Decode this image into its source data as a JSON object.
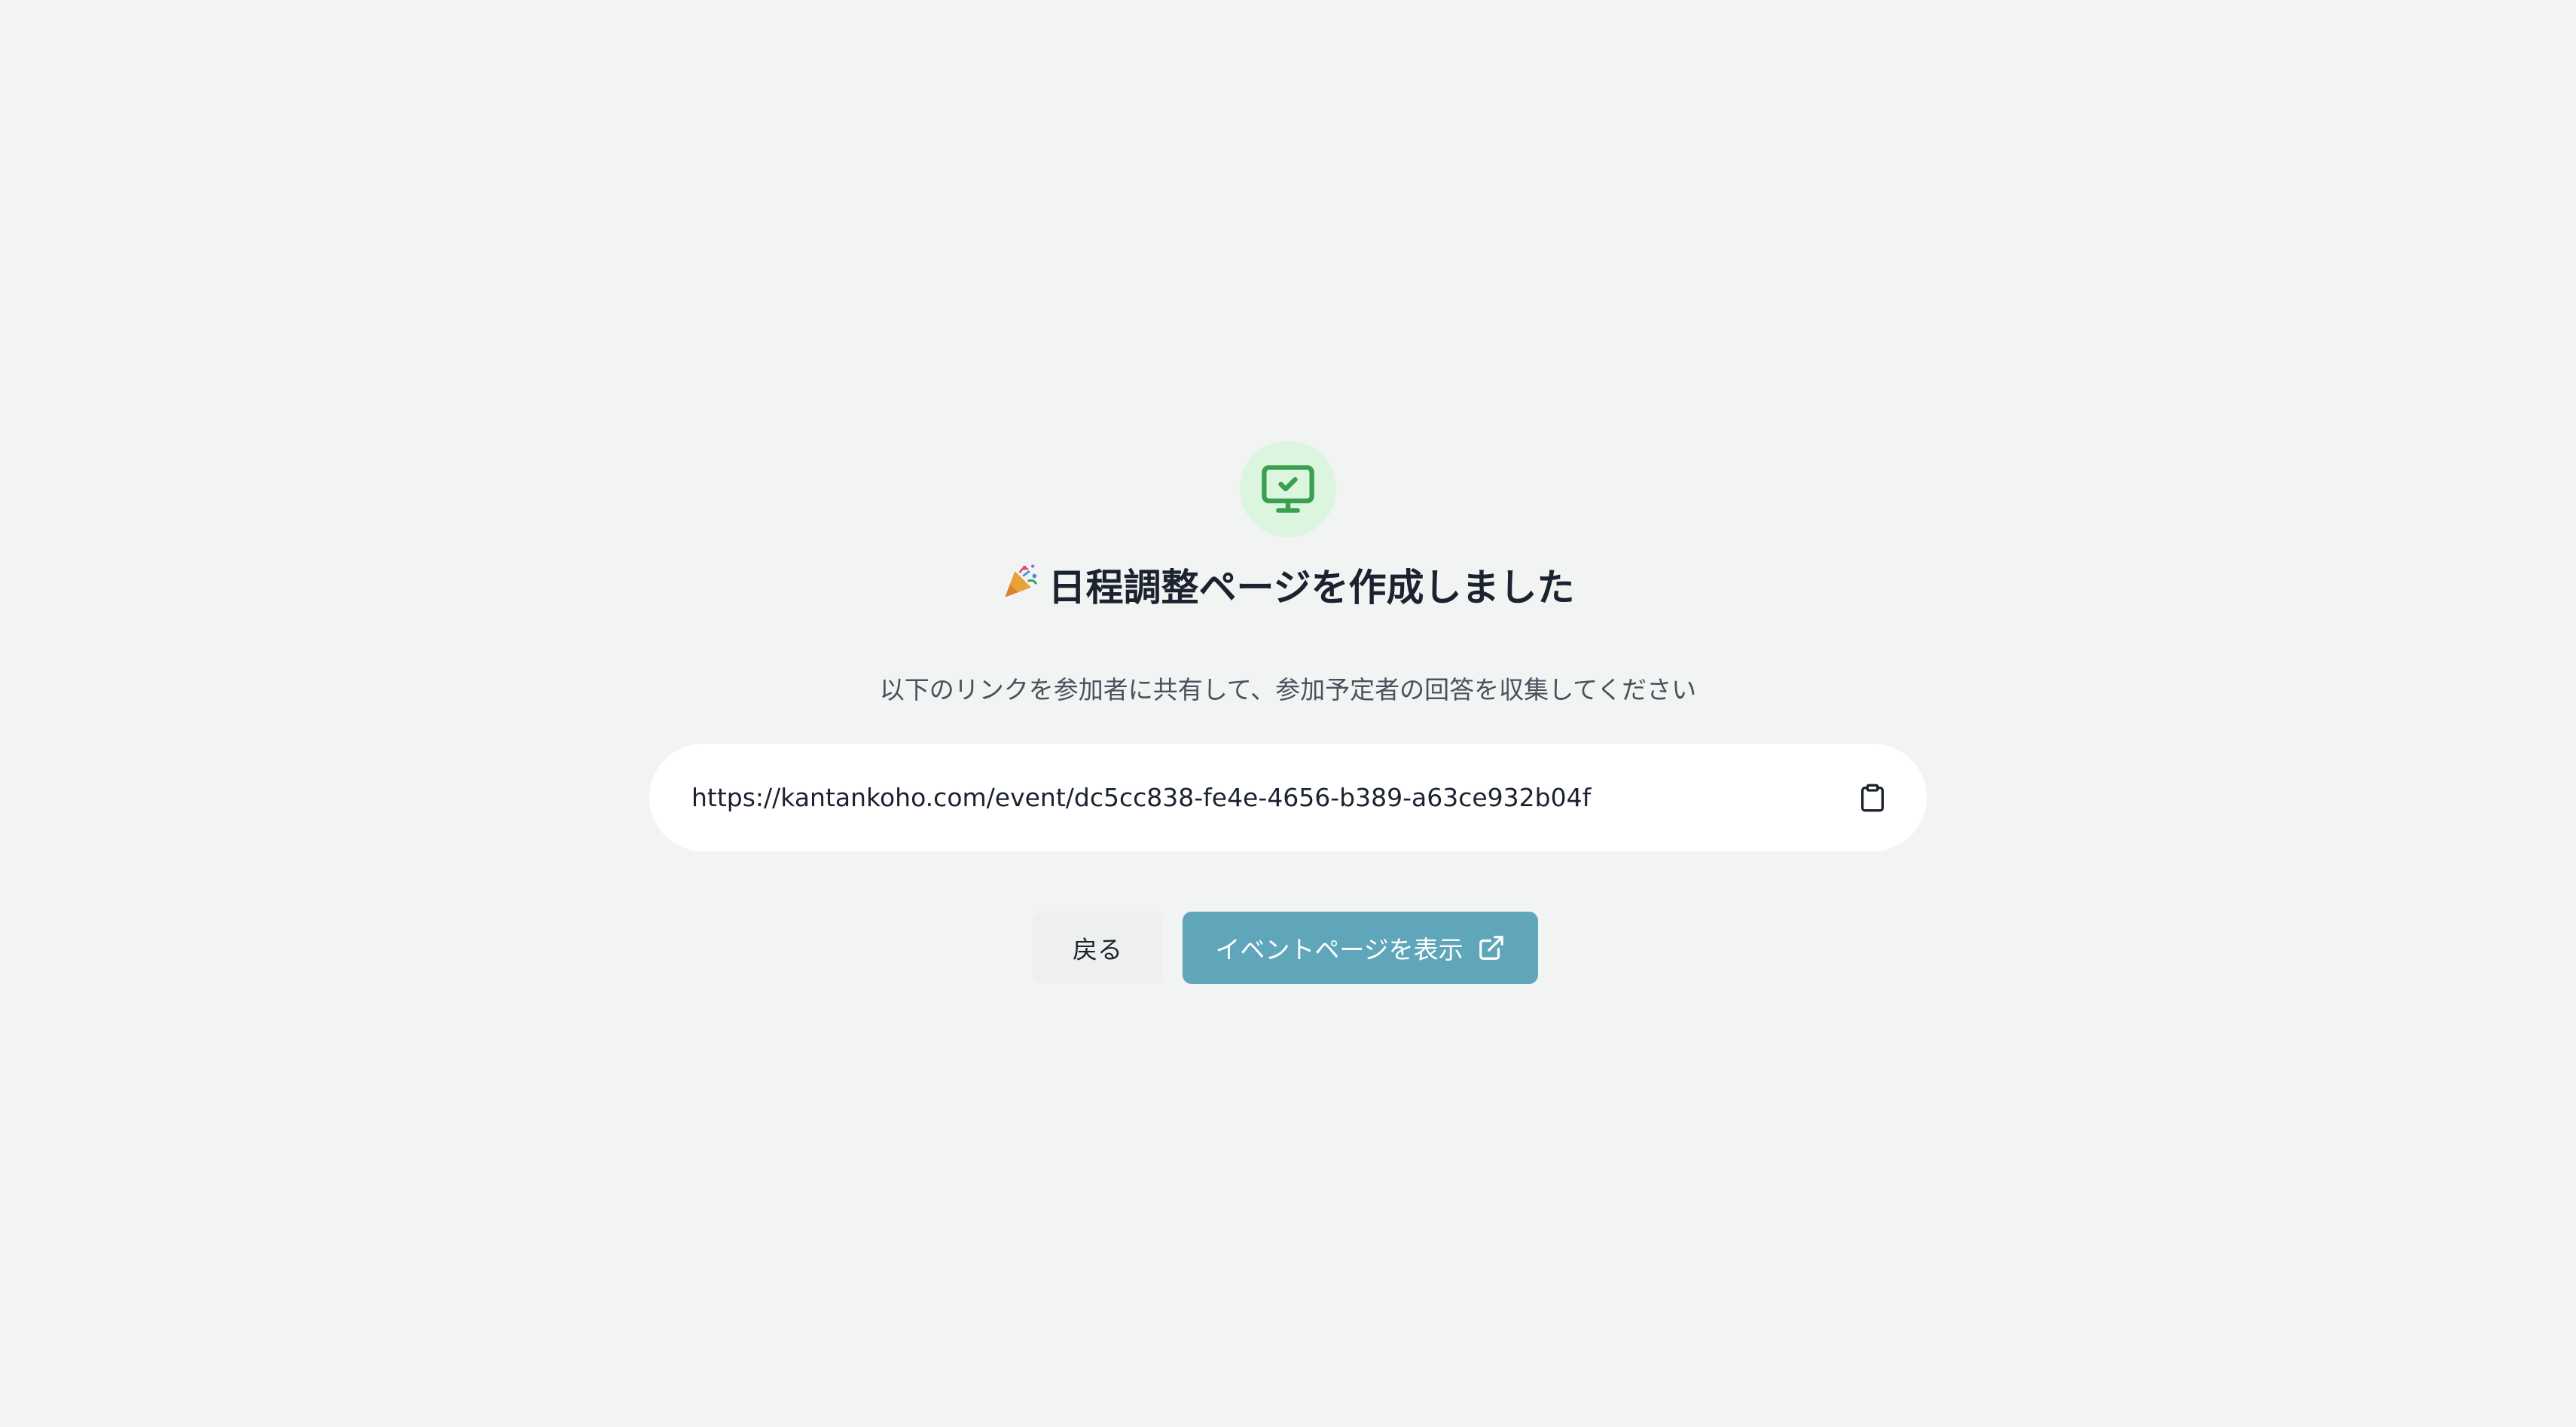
{
  "header": {
    "title_emoji": "🎉",
    "title": "日程調整ページを作成しました",
    "subtitle": "以下のリンクを参加者に共有して、参加予定者の回答を収集してください"
  },
  "link": {
    "url": "https://kantankoho.com/event/dc5cc838-fe4e-4656-b389-a63ce932b04f",
    "copy_icon": "clipboard-icon"
  },
  "actions": {
    "back_label": "戻る",
    "view_label": "イベントページを表示",
    "view_icon": "external-link-icon"
  },
  "icons": {
    "status_icon": "monitor-check-icon"
  },
  "colors": {
    "background": "#f2f4f3",
    "accent": "#5fa6bb",
    "success": "#3aa050",
    "success_bg": "#dcf5df"
  }
}
